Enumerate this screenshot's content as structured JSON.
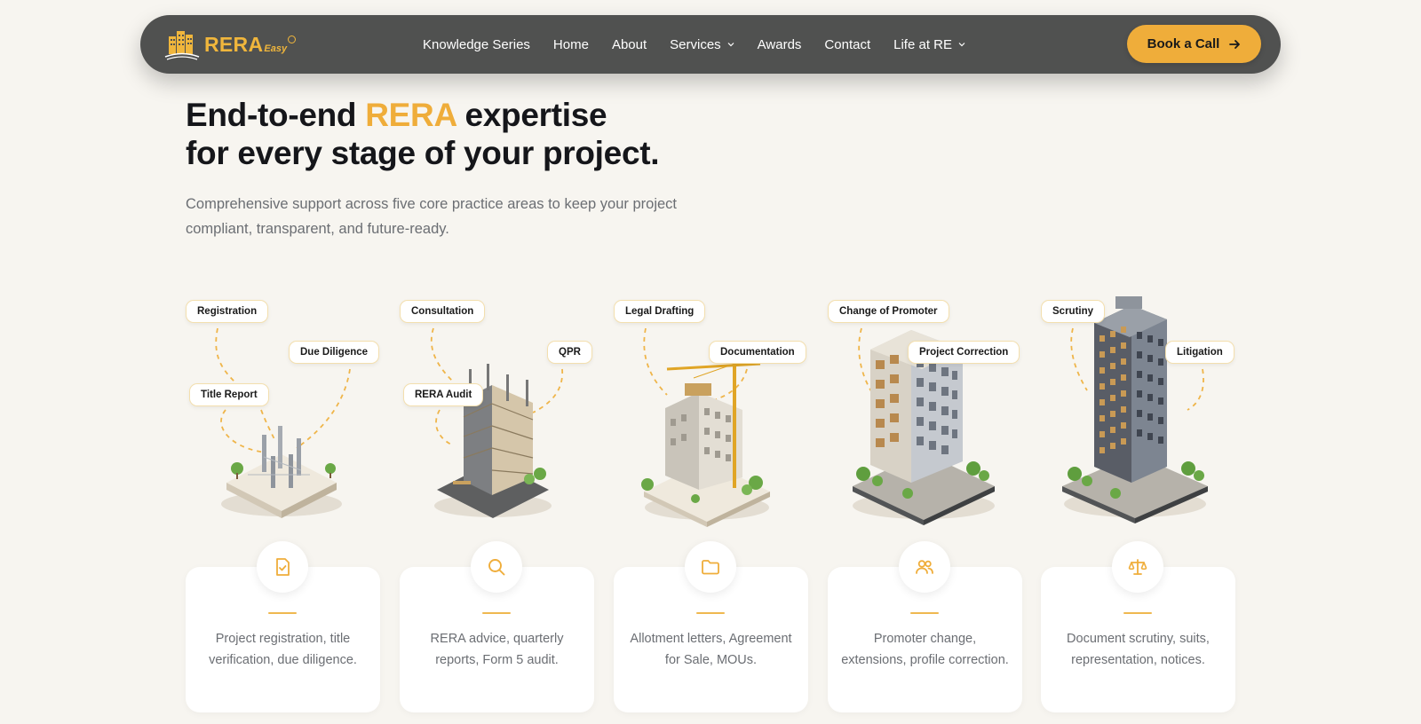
{
  "brand": {
    "name": "RERA",
    "suffix": "Easy",
    "accent": "#efad3a"
  },
  "nav": {
    "items": [
      {
        "label": "Knowledge Series",
        "dropdown": false
      },
      {
        "label": "Home",
        "dropdown": false
      },
      {
        "label": "About",
        "dropdown": false
      },
      {
        "label": "Services",
        "dropdown": true
      },
      {
        "label": "Awards",
        "dropdown": false
      },
      {
        "label": "Contact",
        "dropdown": false
      },
      {
        "label": "Life at RE",
        "dropdown": true
      }
    ],
    "cta": "Book a Call"
  },
  "hero": {
    "title_part1": "End-to-end ",
    "title_accent": "RERA",
    "title_part2": " expertise",
    "title_line2": "for every stage of your project.",
    "subtitle": "Comprehensive support across five core practice areas to keep your project compliant, transparent, and future-ready."
  },
  "stages": [
    {
      "tags": [
        "Registration",
        "Due Diligence",
        "Title Report"
      ],
      "icon": "document-check-icon",
      "description": "Project registration, title verification, due diligence."
    },
    {
      "tags": [
        "Consultation",
        "QPR",
        "RERA Audit"
      ],
      "icon": "search-icon",
      "description": "RERA advice, quarterly reports, Form 5 audit."
    },
    {
      "tags": [
        "Legal Drafting",
        "Documentation"
      ],
      "icon": "folder-icon",
      "description": "Allotment letters, Agreement for Sale, MOUs."
    },
    {
      "tags": [
        "Change of Promoter",
        "Project Correction"
      ],
      "icon": "users-icon",
      "description": "Promoter change, extensions, profile correction."
    },
    {
      "tags": [
        "Scrutiny",
        "Litigation"
      ],
      "icon": "scale-icon",
      "description": "Document scrutiny, suits, representation, notices."
    }
  ]
}
